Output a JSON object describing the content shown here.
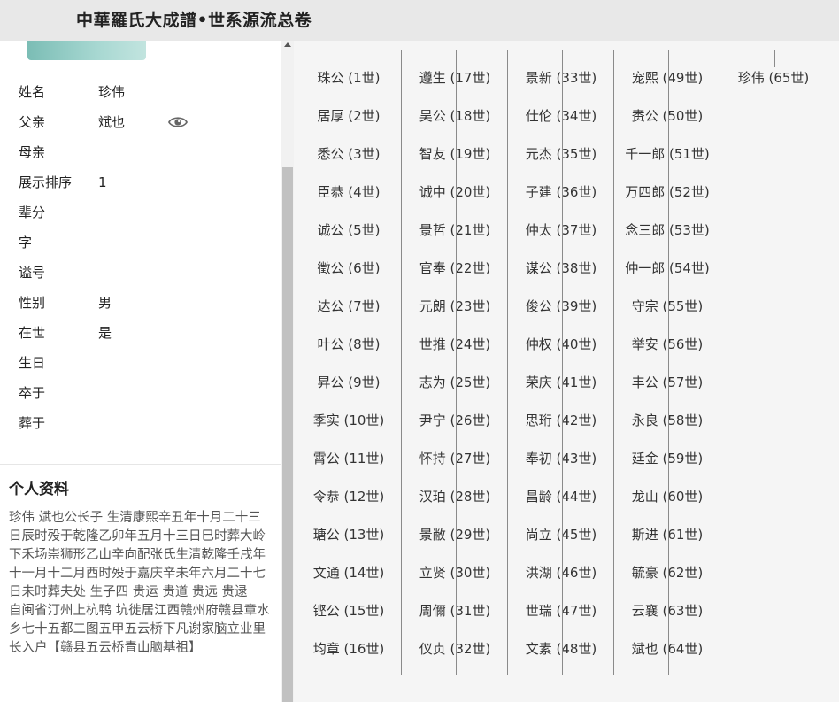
{
  "header": {
    "title": "中華羅氏大成譜•世系源流总卷"
  },
  "profile": {
    "fields": [
      {
        "label": "姓名",
        "value": "珍伟"
      },
      {
        "label": "父亲",
        "value": "斌也"
      },
      {
        "label": "母亲",
        "value": ""
      },
      {
        "label": "展示排序",
        "value": "1"
      },
      {
        "label": "辈分",
        "value": ""
      },
      {
        "label": "字",
        "value": ""
      },
      {
        "label": "谥号",
        "value": ""
      },
      {
        "label": "性别",
        "value": "男"
      },
      {
        "label": "在世",
        "value": "是"
      },
      {
        "label": "生日",
        "value": ""
      },
      {
        "label": "卒于",
        "value": ""
      },
      {
        "label": "葬于",
        "value": ""
      }
    ],
    "father_icon": "eye-icon"
  },
  "bio": {
    "title": "个人资料",
    "text": "珍伟  斌也公长子  生清康熙辛丑年十月二十三日辰时殁于乾隆乙卯年五月十三日巳时葬大岭下禾场崇狮形乙山辛向配张氏生清乾隆壬戌年十一月十二月酉时殁于嘉庆辛未年六月二十七日未时葬夫处  生子四  贵运 贵道 贵远 贵逯\n自闽省汀州上杭鸭 坑徙居江西赣州府赣县章水乡七十五都二图五甲五云桥下凡谢家脑立业里长入户【赣县五云桥青山脑基祖】"
  },
  "tree": {
    "columns": [
      [
        "珠公 (1世)",
        "居厚 (2世)",
        "悉公 (3世)",
        "臣恭 (4世)",
        "诚公 (5世)",
        "徵公 (6世)",
        "达公 (7世)",
        "叶公 (8世)",
        "昇公 (9世)",
        "季实 (10世)",
        "霄公 (11世)",
        "令恭 (12世)",
        "瑭公 (13世)",
        "文通 (14世)",
        "铿公 (15世)",
        "均章 (16世)"
      ],
      [
        "遵生 (17世)",
        "昊公 (18世)",
        "智友 (19世)",
        "诚中 (20世)",
        "景哲 (21世)",
        "官奉 (22世)",
        "元朗 (23世)",
        "世推 (24世)",
        "志为 (25世)",
        "尹宁 (26世)",
        "怀持 (27世)",
        "汉珀 (28世)",
        "景敝 (29世)",
        "立贤 (30世)",
        "周儞 (31世)",
        "仪贞 (32世)"
      ],
      [
        "景新 (33世)",
        "仕伦 (34世)",
        "元杰 (35世)",
        "子建 (36世)",
        "仲太 (37世)",
        "谋公 (38世)",
        "俊公 (39世)",
        "仲权 (40世)",
        "荣庆 (41世)",
        "思珩 (42世)",
        "奉初 (43世)",
        "昌龄 (44世)",
        "尚立 (45世)",
        "洪湖 (46世)",
        "世瑞 (47世)",
        "文素 (48世)"
      ],
      [
        "宠熙 (49世)",
        "赉公 (50世)",
        "千一郎 (51世)",
        "万四郎 (52世)",
        "念三郎 (53世)",
        "仲一郎 (54世)",
        "守宗 (55世)",
        "举安 (56世)",
        "丰公 (57世)",
        "永良 (58世)",
        "廷金 (59世)",
        "龙山 (60世)",
        "斯进 (61世)",
        "毓豪 (62世)",
        "云襄 (63世)",
        "斌也 (64世)"
      ],
      [
        "珍伟 (65世)"
      ]
    ]
  }
}
